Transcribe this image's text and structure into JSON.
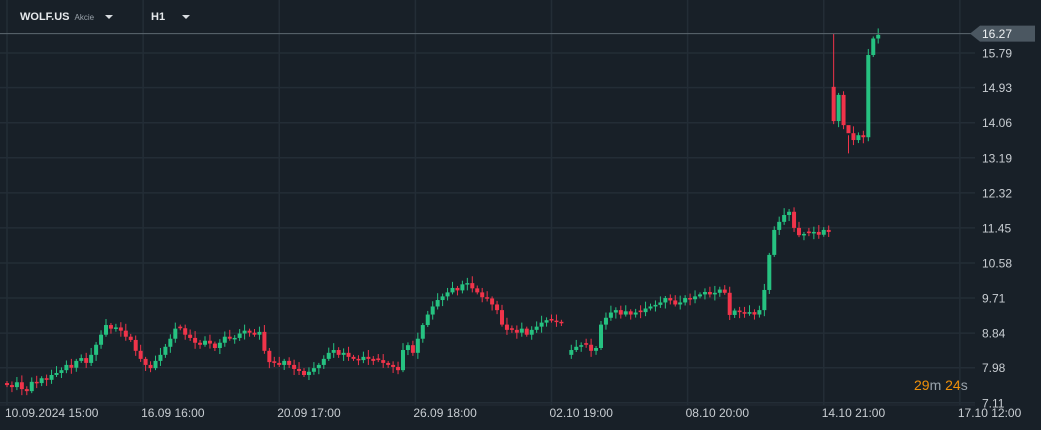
{
  "header": {
    "symbol": "WOLF.US",
    "asset_type": "Akcie",
    "timeframe": "H1"
  },
  "timer": {
    "minutes": "29",
    "m": "m",
    "seconds": "24",
    "s": "s"
  },
  "colors": {
    "up": "#26c281",
    "down": "#f0344a",
    "grid": "#232d36",
    "price_tag": "#4b5761"
  },
  "chart_data": {
    "type": "candlestick",
    "title": "WOLF.US H1",
    "current_price": 16.27,
    "y_ticks": [
      "16.27",
      "15.79",
      "14.93",
      "14.06",
      "13.19",
      "12.32",
      "11.45",
      "10.58",
      "9.71",
      "8.84",
      "7.98",
      "7.11"
    ],
    "ylim": [
      7.0,
      16.6
    ],
    "x_ticks": [
      {
        "slot": 0,
        "label": "10.09.2024  15:00"
      },
      {
        "slot": 27.5,
        "label": "16.09  16:00"
      },
      {
        "slot": 55,
        "label": "20.09  17:00"
      },
      {
        "slot": 82.5,
        "label": "26.09  18:00"
      },
      {
        "slot": 110,
        "label": "02.10  19:00"
      },
      {
        "slot": 137.5,
        "label": "08.10  20:00"
      },
      {
        "slot": 165,
        "label": "14.10  21:00"
      },
      {
        "slot": 192.5,
        "label": "17.10  12:00"
      }
    ],
    "open_overrides": {
      "0": 7.6,
      "114": 8.3,
      "167": 14.95
    },
    "high_overrides": {
      "167": 16.27,
      "176": 16.4,
      "170": 13.3
    },
    "closes": [
      7.55,
      7.5,
      7.62,
      7.45,
      7.4,
      7.63,
      7.6,
      7.72,
      7.68,
      7.8,
      7.85,
      7.92,
      8.05,
      7.98,
      8.15,
      8.22,
      8.1,
      8.3,
      8.55,
      8.8,
      9.04,
      8.95,
      8.98,
      8.9,
      8.75,
      8.67,
      8.4,
      8.2,
      8.05,
      7.97,
      8.15,
      8.3,
      8.5,
      8.7,
      8.95,
      8.96,
      8.8,
      8.72,
      8.6,
      8.55,
      8.65,
      8.58,
      8.47,
      8.6,
      8.75,
      8.7,
      8.72,
      8.83,
      8.9,
      8.85,
      8.8,
      8.87,
      8.4,
      8.12,
      8.1,
      8.05,
      8.15,
      8.05,
      7.95,
      7.9,
      7.8,
      7.88,
      7.97,
      8.05,
      8.2,
      8.35,
      8.42,
      8.3,
      8.35,
      8.25,
      8.2,
      8.17,
      8.25,
      8.2,
      8.15,
      8.17,
      8.1,
      8.05,
      8.0,
      7.92,
      8.42,
      8.54,
      8.35,
      8.7,
      9.04,
      9.3,
      9.5,
      9.66,
      9.75,
      9.85,
      9.96,
      9.9,
      10.05,
      10.08,
      9.95,
      9.85,
      9.73,
      9.7,
      9.55,
      9.41,
      9.05,
      8.92,
      8.92,
      8.85,
      8.95,
      8.8,
      8.92,
      9.0,
      9.1,
      9.16,
      9.15,
      9.12,
      9.09,
      null,
      8.42,
      8.5,
      8.54,
      8.55,
      8.4,
      8.47,
      9.05,
      9.22,
      9.35,
      9.41,
      9.3,
      9.38,
      9.3,
      9.35,
      9.36,
      9.45,
      9.5,
      9.54,
      9.6,
      9.71,
      9.65,
      9.55,
      9.6,
      9.71,
      9.68,
      9.75,
      9.8,
      9.86,
      9.8,
      9.84,
      9.92,
      9.84,
      9.29,
      9.4,
      9.36,
      9.32,
      9.36,
      9.3,
      9.41,
      9.91,
      10.78,
      11.4,
      11.6,
      11.77,
      11.85,
      11.45,
      11.27,
      11.3,
      11.32,
      11.35,
      11.28,
      11.4,
      11.35,
      14.1,
      14.75,
      14.0,
      13.8,
      13.63,
      13.75,
      13.7,
      15.74,
      16.15,
      16.24
    ]
  }
}
